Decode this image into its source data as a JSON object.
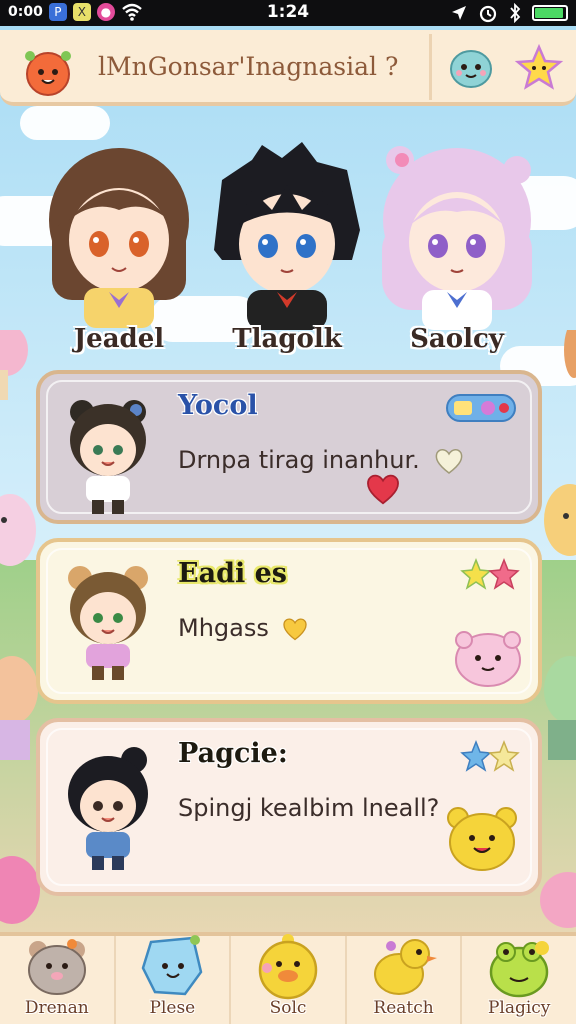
{
  "status_bar": {
    "carrier": "0:00",
    "time": "1:24"
  },
  "header": {
    "title": "lMnGonsar'Inagnasial ?"
  },
  "characters": [
    {
      "name": "Jeadel"
    },
    {
      "name": "Tlagolk"
    },
    {
      "name": "Saolcy"
    }
  ],
  "cards": [
    {
      "name": "Yocol",
      "text": "Drnpa tirag inanhur."
    },
    {
      "name": "Eadi es",
      "text": "Mhgass"
    },
    {
      "name": "Pagcie:",
      "text": "Spingj kealbim lneall?"
    }
  ],
  "bottom_nav": [
    {
      "label": "Drenan"
    },
    {
      "label": "Plese"
    },
    {
      "label": "Solc"
    },
    {
      "label": "Reatch"
    },
    {
      "label": "Plagicy"
    }
  ],
  "colors": {
    "header_bg": "#fbecd6",
    "card_1": "#d8cfd6",
    "card_2": "#fbf6e3",
    "card_3": "#fbefe8",
    "accent_brown": "#8d5a3a"
  }
}
